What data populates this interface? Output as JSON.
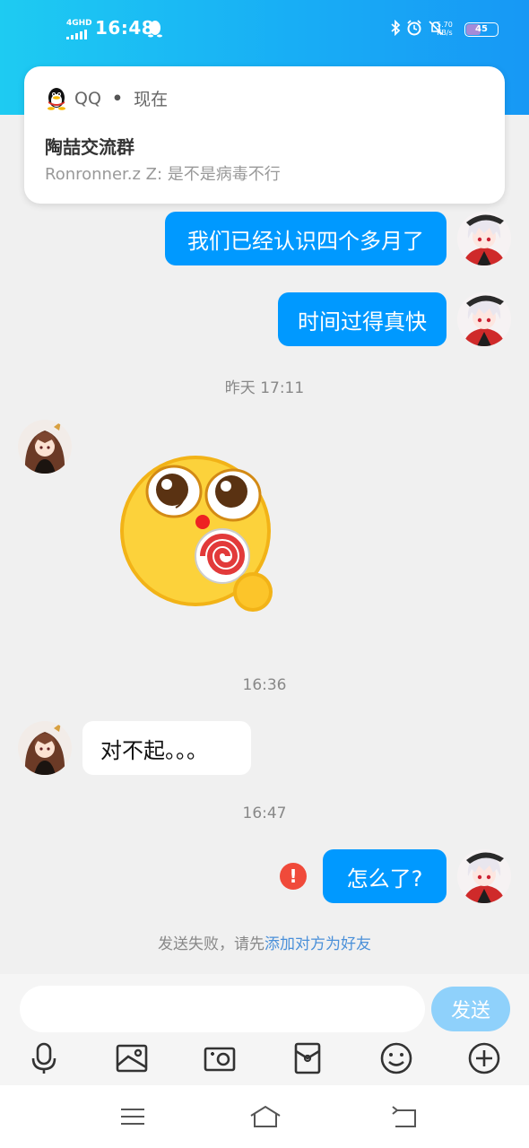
{
  "status_bar": {
    "network": "4GHD",
    "time": "16:48",
    "speed_value": "5.70",
    "speed_unit": "KB/s",
    "battery": "45",
    "battery_level": 0.45,
    "icons": [
      "qq-penguin-icon",
      "bluetooth-icon",
      "alarm-icon",
      "mute-icon"
    ]
  },
  "notification": {
    "app": "QQ",
    "separator": "•",
    "time": "现在",
    "title": "陶喆交流群",
    "body": "Ronronner.z Z: 是不是病毒不行"
  },
  "messages": {
    "out_1": "我们已经认识四个多月了",
    "out_2": "时间过得真快",
    "ts_1": "昨天 17:11",
    "sticker": "lollipop-emoji-sticker",
    "ts_2": "16:36",
    "in_1": "对不起。。。",
    "ts_3": "16:47",
    "out_3": "怎么了?",
    "error_mark": "!"
  },
  "fail_note": {
    "prefix": "发送失败，请先",
    "link": "添加对方为好友"
  },
  "input": {
    "placeholder": "",
    "send_label": "发送"
  },
  "toolbar": [
    "microphone-icon",
    "image-icon",
    "camera-icon",
    "red-packet-icon",
    "emoji-icon",
    "plus-icon"
  ],
  "navbar": [
    "menu-icon",
    "home-icon",
    "back-icon"
  ],
  "colors": {
    "header_start": "#1ecbf2",
    "header_end": "#1798f5",
    "bubble_out": "#0099ff",
    "send_button": "#8fd1fb",
    "error": "#f04a3a",
    "link": "#4a90d9"
  }
}
